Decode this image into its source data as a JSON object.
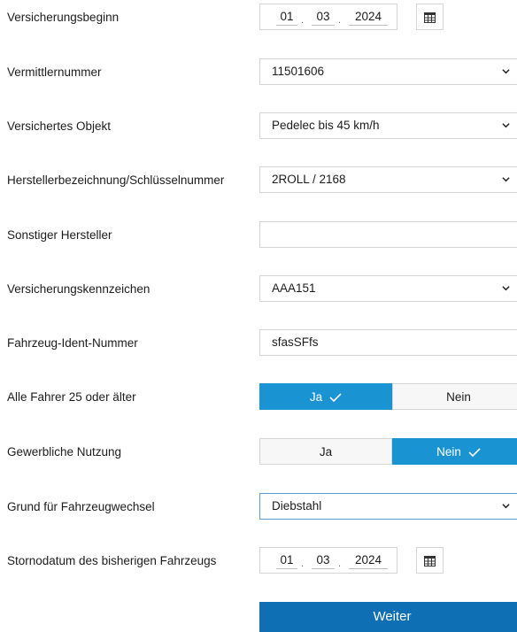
{
  "fields": {
    "versicherungsbeginn": {
      "label": "Versicherungsbeginn",
      "day": "01",
      "month": "03",
      "year": "2024"
    },
    "vermittlernummer": {
      "label": "Vermittlernummer",
      "value": "11501606"
    },
    "versichertes_objekt": {
      "label": "Versichertes Objekt",
      "value": "Pedelec bis 45 km/h"
    },
    "hersteller": {
      "label": "Herstellerbezeichnung/Schlüsselnummer",
      "value": "2ROLL / 2168"
    },
    "sonstiger_hersteller": {
      "label": "Sonstiger Hersteller",
      "value": ""
    },
    "kennzeichen": {
      "label": "Versicherungskennzeichen",
      "value": "AAA151"
    },
    "fin": {
      "label": "Fahrzeug-Ident-Nummer",
      "value": "sfasSFfs"
    },
    "alle_fahrer": {
      "label": "Alle Fahrer 25 oder älter",
      "yes": "Ja",
      "no": "Nein",
      "selected": "Ja"
    },
    "gewerblich": {
      "label": "Gewerbliche Nutzung",
      "yes": "Ja",
      "no": "Nein",
      "selected": "Nein"
    },
    "grund": {
      "label": "Grund für Fahrzeugwechsel",
      "value": "Diebstahl"
    },
    "stornodatum": {
      "label": "Stornodatum des bisherigen Fahrzeugs",
      "day": "01",
      "month": "03",
      "year": "2024"
    }
  },
  "submit_label": "Weiter",
  "icons": {
    "calendar": "calendar-icon",
    "dropdown": "chevron-down-icon",
    "check": "check-icon"
  },
  "colors": {
    "primary": "#1a93d3",
    "button": "#0f6fb5"
  }
}
